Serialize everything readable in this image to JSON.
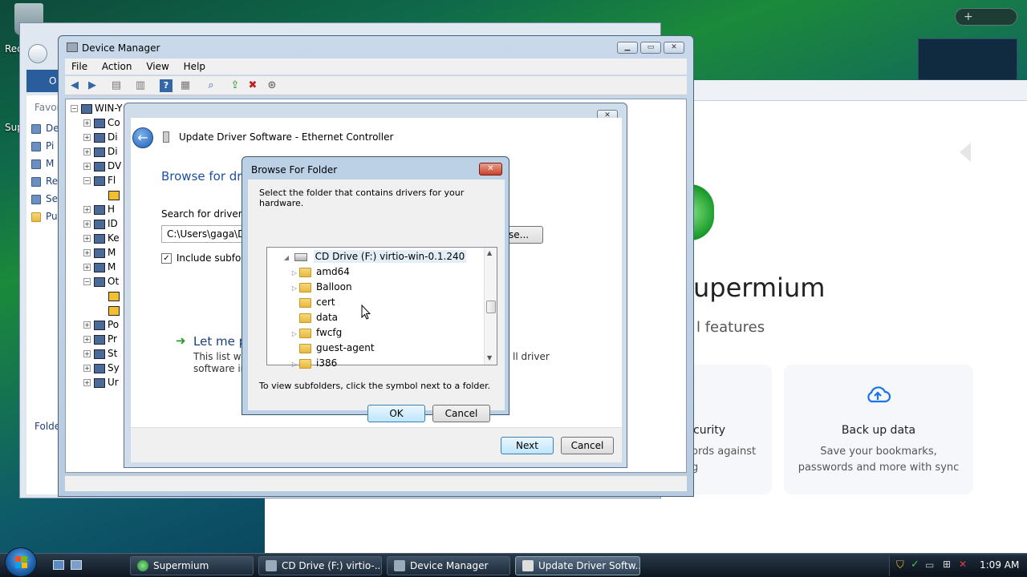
{
  "desktop": {
    "recycle_label": "Rec",
    "super_label": "Sup"
  },
  "browser": {
    "title_partial": "upermium",
    "subtitle_partial": "l features",
    "card1_title_partial": "curity",
    "card1_text_line1": "ords against",
    "card1_text_line2": "g",
    "card2_title": "Back up data",
    "card2_text_line1": "Save your bookmarks,",
    "card2_text_line2": "passwords and more with sync"
  },
  "explorer": {
    "favorites_label": "Favor",
    "links": [
      "De",
      "Pi",
      "M",
      "Re",
      "Se",
      "Pu"
    ],
    "folders_label": "Folde",
    "nav_label": "O"
  },
  "device_manager": {
    "title": "Device Manager",
    "menu": [
      "File",
      "Action",
      "View",
      "Help"
    ],
    "root_label": "WIN-Y",
    "tree_items": [
      "Co",
      "Di",
      "Di",
      "DV",
      "Fl",
      "",
      "H",
      "ID",
      "Ke",
      "M",
      "M",
      "Ot",
      "",
      "",
      "Po",
      "Pr",
      "St",
      "Sy",
      "Ur"
    ]
  },
  "update_driver": {
    "title": "Update Driver Software - Ethernet Controller",
    "heading": "Browse for driv",
    "search_label": "Search for driver so",
    "path_value": "C:\\Users\\gaga\\Do",
    "browse_label": "se...",
    "include_subfolders": "Include subfolde",
    "let_me_pick": "Let me pic",
    "list_text_line1": "This list will s",
    "list_text_line1_tail": "ll driver",
    "list_text_line2": "software in th",
    "next_label": "Next",
    "cancel_label": "Cancel"
  },
  "browse_folder": {
    "title": "Browse For Folder",
    "instruction": "Select the folder that contains drivers for your hardware.",
    "drive_label": "CD Drive (F:) virtio-win-0.1.240",
    "folders": [
      {
        "name": "amd64",
        "expandable": true
      },
      {
        "name": "Balloon",
        "expandable": true
      },
      {
        "name": "cert",
        "expandable": false
      },
      {
        "name": "data",
        "expandable": false
      },
      {
        "name": "fwcfg",
        "expandable": true
      },
      {
        "name": "guest-agent",
        "expandable": false
      },
      {
        "name": "i386",
        "expandable": true
      }
    ],
    "hint": "To view subfolders, click the symbol next to a folder.",
    "ok_label": "OK",
    "cancel_label": "Cancel"
  },
  "taskbar": {
    "items": [
      {
        "label": "Supermium",
        "active": false
      },
      {
        "label": "CD Drive (F:) virtio-...",
        "active": false
      },
      {
        "label": "Device Manager",
        "active": false
      },
      {
        "label": "Update Driver Softw...",
        "active": true
      }
    ],
    "clock": "1:09 AM"
  }
}
